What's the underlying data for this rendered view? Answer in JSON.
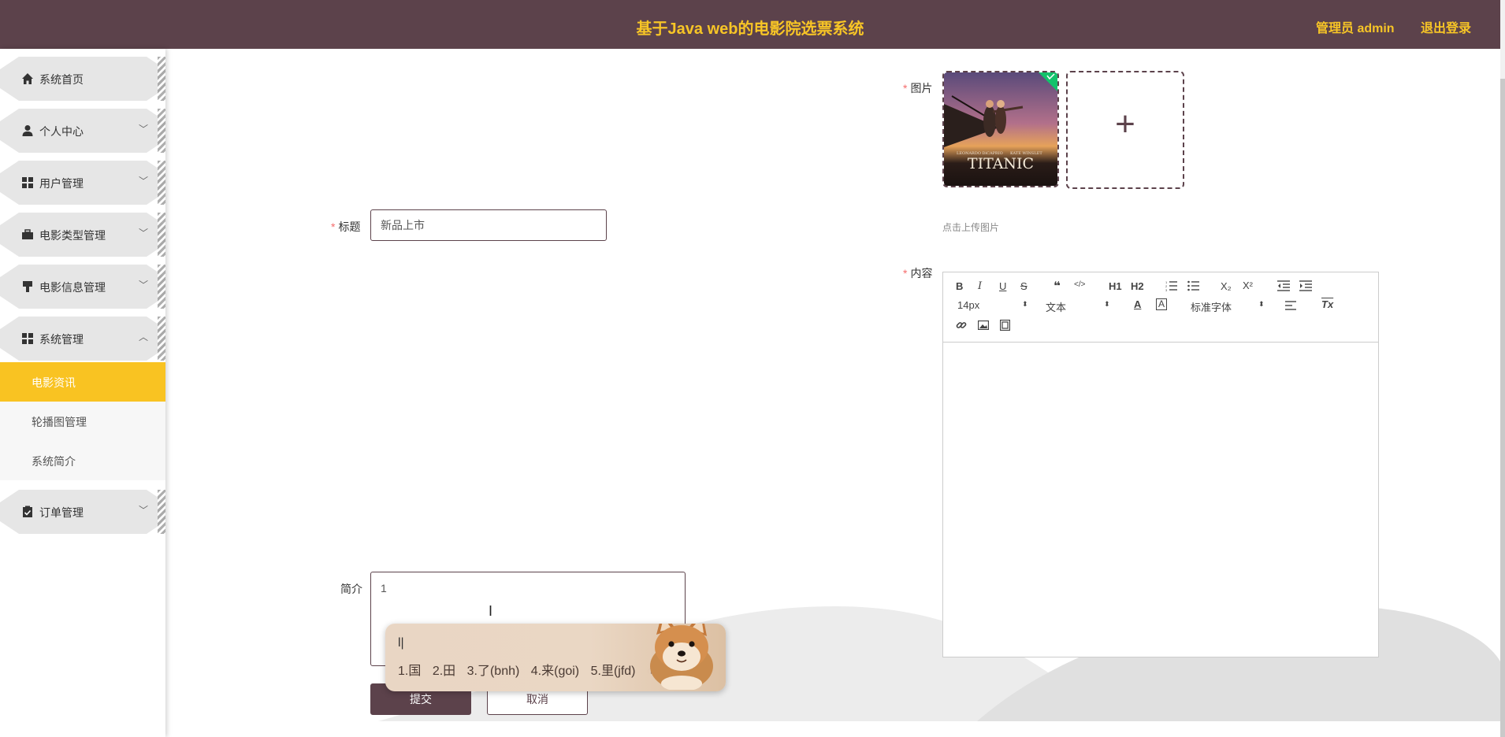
{
  "header": {
    "title": "基于Java web的电影院选票系统",
    "user": "管理员 admin",
    "logout": "退出登录"
  },
  "sidebar": {
    "items": [
      {
        "label": "系统首页",
        "icon": "home-icon"
      },
      {
        "label": "个人中心",
        "icon": "user-icon"
      },
      {
        "label": "用户管理",
        "icon": "grid-icon"
      },
      {
        "label": "电影类型管理",
        "icon": "briefcase-icon"
      },
      {
        "label": "电影信息管理",
        "icon": "brush-icon"
      },
      {
        "label": "系统管理",
        "icon": "grid-icon"
      },
      {
        "label": "订单管理",
        "icon": "clipboard-icon"
      }
    ],
    "sub_items": [
      {
        "label": "电影资讯",
        "active": true
      },
      {
        "label": "轮播图管理",
        "active": false
      },
      {
        "label": "系统简介",
        "active": false
      }
    ]
  },
  "form": {
    "title_label": "标题",
    "title_value": "新品上市",
    "summary_label": "简介",
    "summary_value": "1",
    "image_label": "图片",
    "image_alt": "TITANIC",
    "image_credits": [
      "LEONARDO DiCAPRIO",
      "KATE WINSLET"
    ],
    "upload_tip": "点击上传图片",
    "content_label": "内容",
    "submit_label": "提交",
    "cancel_label": "取消"
  },
  "editor": {
    "buttons": [
      "B",
      "I",
      "U",
      "S",
      "❝",
      "</>",
      "H1",
      "H2",
      "ordered-list",
      "bullet-list",
      "X₂",
      "X²",
      "outdent",
      "indent"
    ],
    "font_size": "14px",
    "text_type": "文本",
    "font_family": "标准字体",
    "row2_icons": [
      "font-color-icon",
      "background-color-icon",
      "align-icon",
      "clear-format-icon"
    ],
    "row3_icons": [
      "link-icon",
      "image-icon",
      "video-icon"
    ]
  },
  "ime": {
    "composition": "l|",
    "candidates": [
      "1.国",
      "2.田",
      "3.了(bnh)",
      "4.来(goi)",
      "5.里(jfd)"
    ]
  },
  "colors": {
    "header_bg": "#5c424b",
    "header_text": "#f7c526",
    "active_menu": "#f9c322",
    "required": "#f56c6c"
  }
}
